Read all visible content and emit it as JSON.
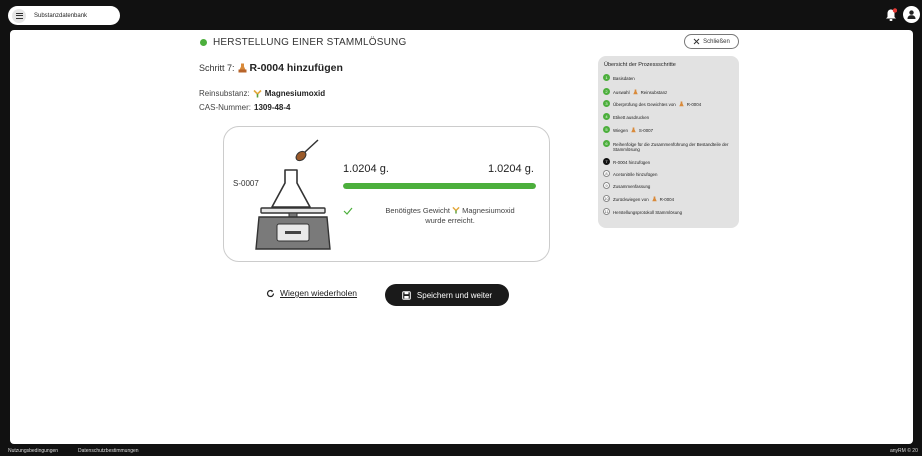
{
  "topbar": {
    "menu_label": "Substanzdatenbank"
  },
  "footer": {
    "terms": "Nutzungsbedingungen",
    "privacy": "Datenschutzbestimmungen",
    "copyright": "anyRM © 20"
  },
  "process": {
    "title": "HERSTELLUNG EINER STAMMLÖSUNG",
    "close_label": "Schließen",
    "step_prefix": "Schritt 7:",
    "step_object": "R-0004 hinzufügen",
    "substance_label": "Reinsubstanz:",
    "substance_value": "Magnesiumoxid",
    "cas_label": "CAS-Nummer:",
    "cas_value": "1309-48-4"
  },
  "weighing": {
    "container_label": "S-0007",
    "measured": "1.0204 g.",
    "target": "1.0204 g.",
    "progress_fraction": 1.0,
    "message_prefix": "Benötigtes Gewicht",
    "message_substance": "Magnesiumoxid",
    "message_suffix": "wurde erreicht."
  },
  "actions": {
    "repeat_label": "Wiegen wiederholen",
    "save_label": "Speichern und weiter"
  },
  "overview": {
    "title": "Übersicht der Prozessschritte",
    "steps": [
      {
        "num": "1",
        "state": "done",
        "text": "Basisdaten"
      },
      {
        "num": "2",
        "state": "done",
        "text": "Auswahl",
        "text2": "Reinsubstanz"
      },
      {
        "num": "3",
        "state": "done",
        "text": "Überprüfung des Gewichtes von",
        "text2": "R-0004"
      },
      {
        "num": "4",
        "state": "done",
        "text": "Etikett ausdrucken"
      },
      {
        "num": "5",
        "state": "done",
        "text": "Wiegen",
        "text2": "S-0007"
      },
      {
        "num": "6",
        "state": "done",
        "text": "Reihenfolge für die Zusammenführung der Bestandteile der Stammlösung"
      },
      {
        "num": "7",
        "state": "current",
        "text": "R-0004 hinzufügen"
      },
      {
        "num": "8",
        "state": "todo",
        "text": "Acetonitrile hinzufügen"
      },
      {
        "num": "9",
        "state": "todo",
        "text": "Zusammenfassung"
      },
      {
        "num": "10",
        "state": "todo",
        "text": "Zurückwiegen von",
        "text2": "R-0004"
      },
      {
        "num": "11",
        "state": "todo",
        "text": "Herstellungsprotokoll Stammlösung"
      }
    ]
  },
  "colors": {
    "accent_green": "#4caf3c",
    "flask_orange": "#d98a3a",
    "dark": "#1a1a1a",
    "panel_bg": "#e2e2e2"
  },
  "icons": [
    "menu-icon",
    "bell-icon",
    "user-icon",
    "close-icon",
    "flask-icon",
    "substance-icon",
    "scale-icon",
    "check-icon",
    "refresh-icon",
    "save-icon"
  ]
}
